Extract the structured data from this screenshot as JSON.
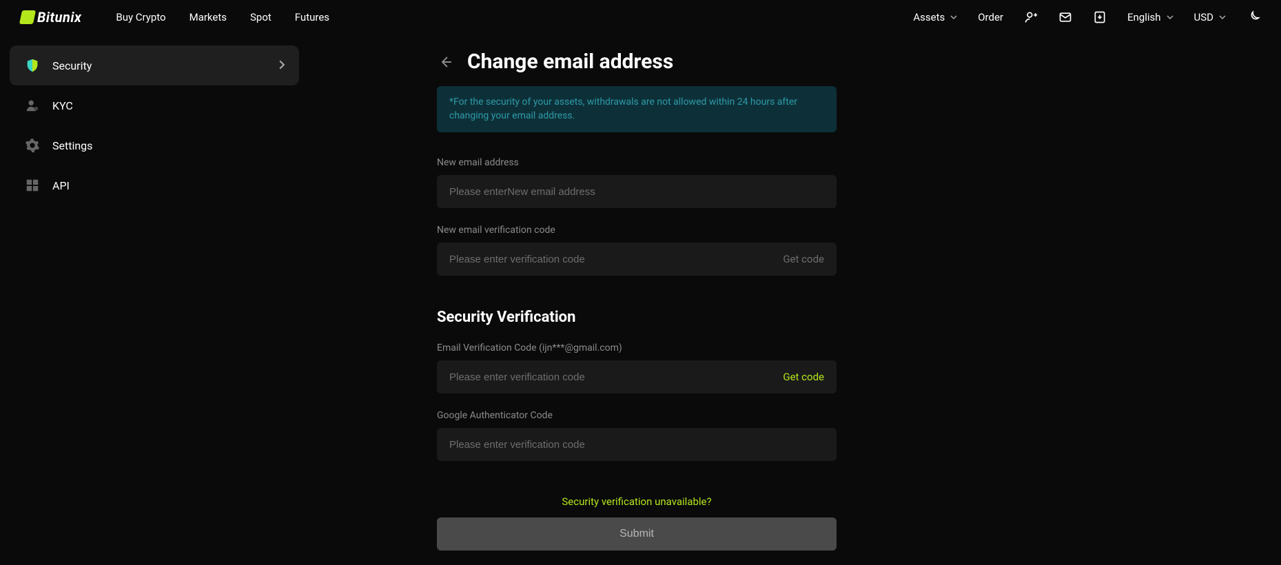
{
  "brand": {
    "name": "Bitunix"
  },
  "nav": {
    "buy_crypto": "Buy Crypto",
    "markets": "Markets",
    "spot": "Spot",
    "futures": "Futures",
    "assets": "Assets",
    "order": "Order",
    "language": "English",
    "currency": "USD"
  },
  "sidebar": {
    "items": [
      {
        "label": "Security"
      },
      {
        "label": "KYC"
      },
      {
        "label": "Settings"
      },
      {
        "label": "API"
      }
    ]
  },
  "page": {
    "title": "Change email address",
    "notice": "*For the security of your assets, withdrawals are not allowed within 24 hours after changing your email address.",
    "new_email_label": "New email address",
    "new_email_placeholder": "Please enterNew email address",
    "new_code_label": "New email verification code",
    "code_placeholder": "Please enter verification code",
    "get_code": "Get code",
    "sec_verif_title": "Security Verification",
    "email_code_label": "Email Verification Code (ijn***@gmail.com)",
    "google_label": "Google Authenticator Code",
    "help_link": "Security verification unavailable?",
    "submit": "Submit"
  }
}
